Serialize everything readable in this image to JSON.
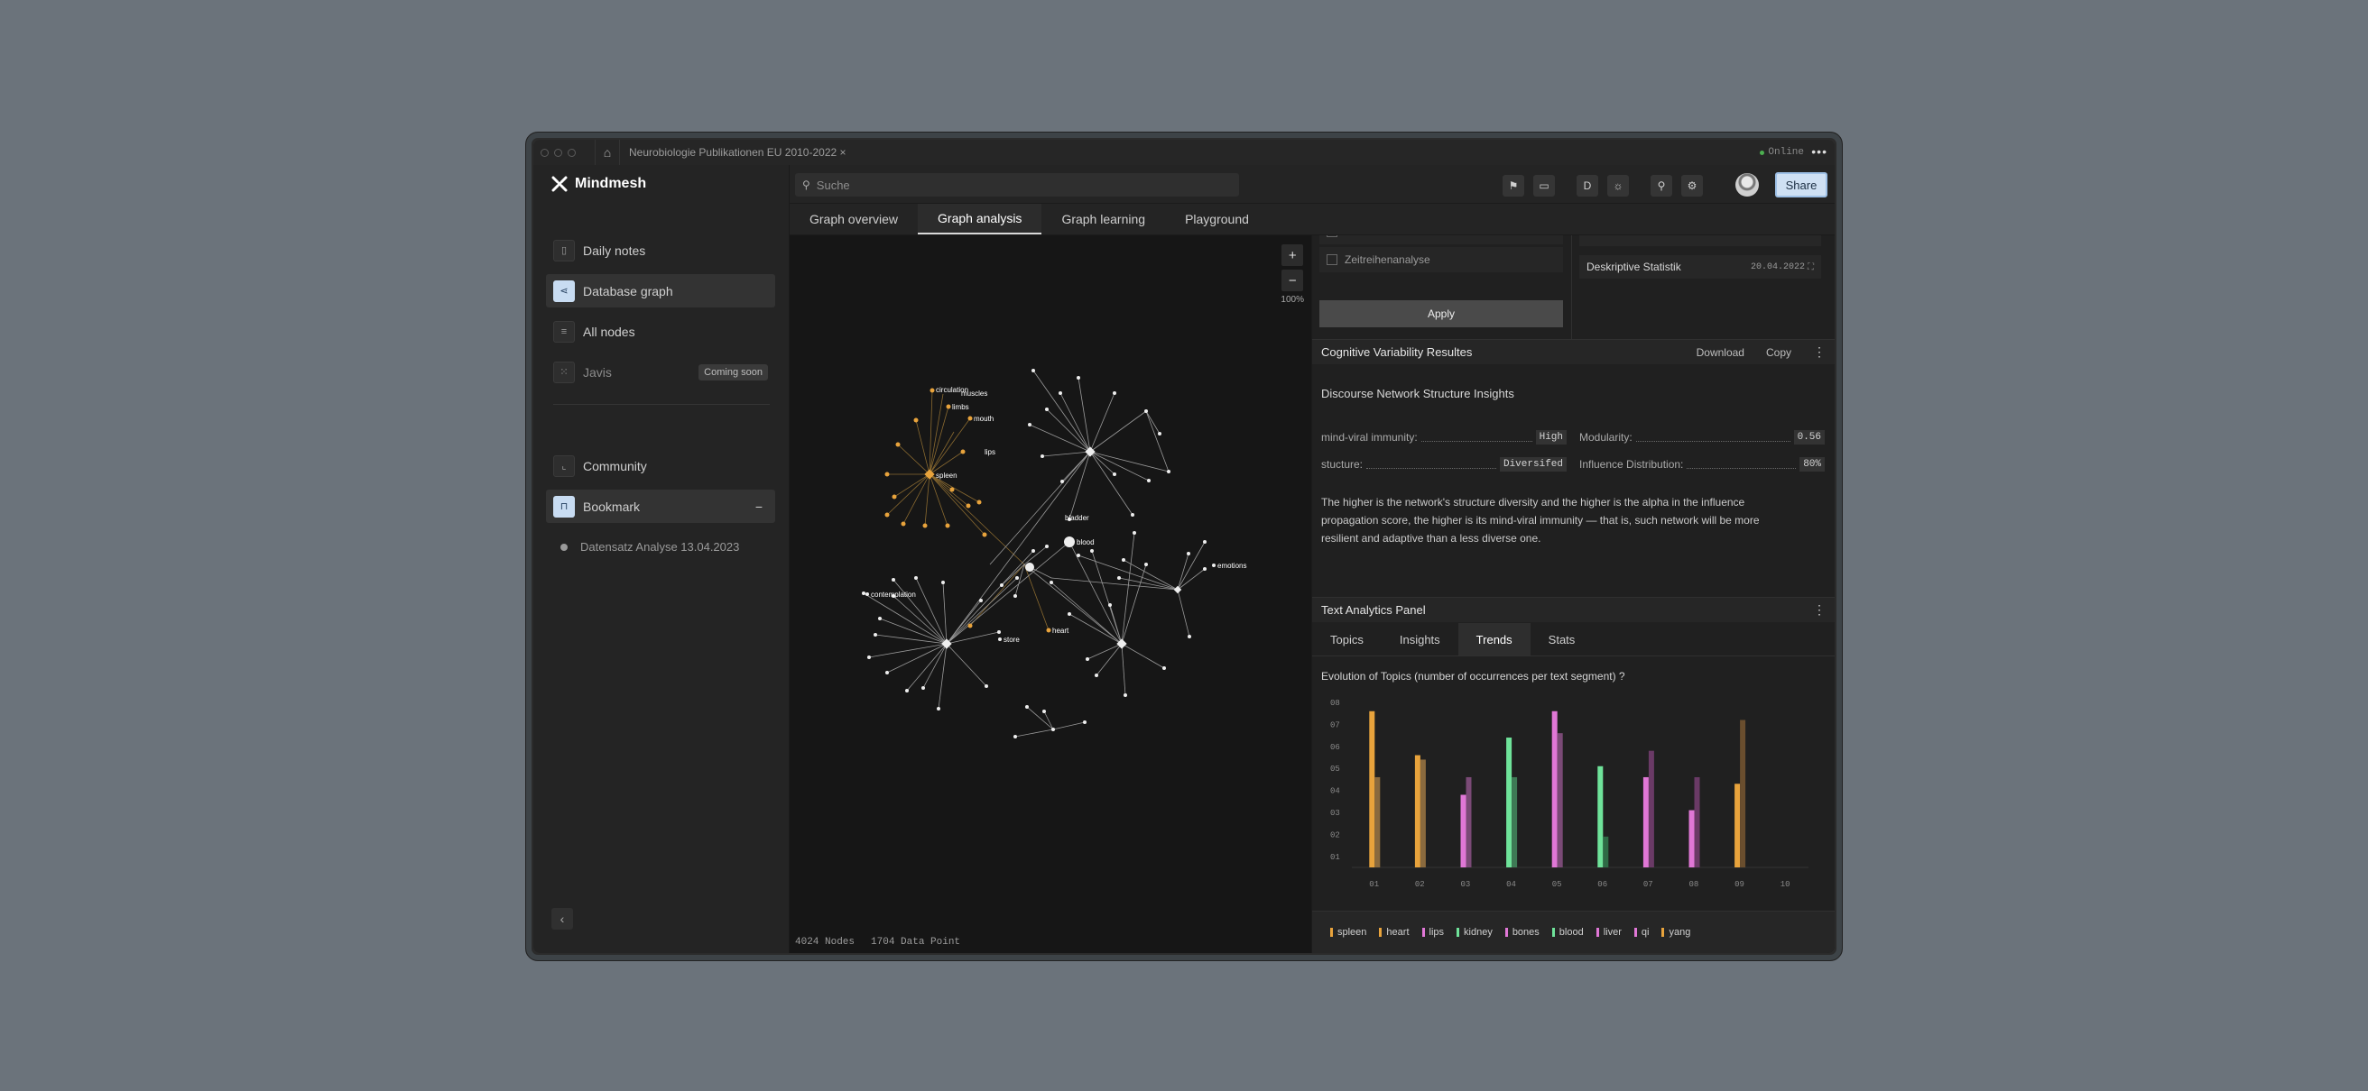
{
  "window": {
    "tab_title": "Neurobiologie Publikationen EU 2010-2022 ×",
    "status": "Online"
  },
  "brand": {
    "name": "Mindmesh"
  },
  "sidebar": {
    "items": [
      {
        "label": "Daily notes",
        "icon": "note-icon"
      },
      {
        "label": "Database graph",
        "icon": "graph-icon",
        "active": true
      },
      {
        "label": "All nodes",
        "icon": "list-icon"
      },
      {
        "label": "Javis",
        "icon": "grid-icon",
        "badge": "Coming soon"
      }
    ],
    "items2": [
      {
        "label": "Community",
        "icon": "community-icon"
      },
      {
        "label": "Bookmark",
        "icon": "bookmark-icon",
        "active": true,
        "action": "−"
      },
      {
        "label": "Datensatz Analyse 13.04.2023"
      }
    ]
  },
  "header": {
    "search_placeholder": "Suche",
    "btn_d": "D",
    "share_label": "Share"
  },
  "view_tabs": [
    "Graph overview",
    "Graph analysis",
    "Graph learning",
    "Playground"
  ],
  "graph": {
    "zoom_in": "+",
    "zoom_out": "−",
    "zoom_level": "100%",
    "nodes_count": "4024 Nodes",
    "data_points": "1704 Data Point",
    "labels": {
      "spleen": "spleen",
      "circulation": "circulation",
      "muscles": "muscles",
      "limbs": "limbs",
      "mouth": "mouth",
      "lips": "lips",
      "bladder": "bladder",
      "blood": "blood",
      "emotions": "emotions",
      "contemplation": "contemplation",
      "heart": "heart",
      "store": "store"
    }
  },
  "filters": {
    "row2": "Zeitreihenanalyse",
    "apply": "Apply"
  },
  "saved": {
    "name": "Deskriptive Statistik",
    "date": "20.04.2022"
  },
  "cognitive": {
    "title": "Cognitive Variability Resultes",
    "download": "Download",
    "copy": "Copy",
    "insight_title": "Discourse Network Structure Insights",
    "m1_label": "mind-viral immunity:",
    "m1_value": "High",
    "m2_label": "Modularity:",
    "m2_value": "0.56",
    "m3_label": "stucture:",
    "m3_value": "Diversifed",
    "m4_label": "Influence Distribution:",
    "m4_value": "80%",
    "paragraph": "The higher is the network's structure diversity and the higher is the alpha in the influence propagation score, the higher is its mind-viral immunity — that is, such network will be more resilient and adaptive than a less diverse one."
  },
  "text_panel": {
    "title": "Text Analytics Panel",
    "tabs": [
      "Topics",
      "Insights",
      "Trends",
      "Stats"
    ],
    "active_tab": "Trends"
  },
  "chart_data": {
    "type": "bar",
    "title": "Evolution of Topics (number of occurrences per text segment) ?",
    "categories": [
      "01",
      "02",
      "03",
      "04",
      "05",
      "06",
      "07",
      "08",
      "09",
      "10"
    ],
    "y_ticks": [
      "08",
      "07",
      "06",
      "05",
      "04",
      "03",
      "02",
      "01"
    ],
    "ylim": [
      0.5,
      8
    ],
    "bars": [
      {
        "cat": 0,
        "values": [
          7.6,
          4.6
        ],
        "colors": [
          "#e8a33c",
          "#8a6a3e"
        ]
      },
      {
        "cat": 1,
        "values": [
          5.6,
          5.4
        ],
        "colors": [
          "#e8a33c",
          "#8a6a3e"
        ]
      },
      {
        "cat": 2,
        "values": [
          3.8,
          4.6
        ],
        "colors": [
          "#e077d6",
          "#7a4a76"
        ]
      },
      {
        "cat": 3,
        "values": [
          6.4,
          4.6
        ],
        "colors": [
          "#6fe39a",
          "#3e7a55"
        ]
      },
      {
        "cat": 4,
        "values": [
          7.6,
          6.6
        ],
        "colors": [
          "#e077d6",
          "#7a4a76"
        ]
      },
      {
        "cat": 5,
        "values": [
          5.1,
          1.9
        ],
        "colors": [
          "#6fe39a",
          "#2e6a45"
        ]
      },
      {
        "cat": 6,
        "values": [
          4.6,
          5.8
        ],
        "colors": [
          "#e077d6",
          "#6a3a66"
        ]
      },
      {
        "cat": 7,
        "values": [
          3.1,
          4.6
        ],
        "colors": [
          "#e077d6",
          "#6a3a66"
        ]
      },
      {
        "cat": 8,
        "values": [
          4.3,
          7.2
        ],
        "colors": [
          "#e8a33c",
          "#6a4e2e"
        ]
      }
    ],
    "legend": [
      {
        "name": "spleen",
        "color": "#e8a33c"
      },
      {
        "name": "heart",
        "color": "#e8a33c"
      },
      {
        "name": "lips",
        "color": "#e077d6"
      },
      {
        "name": "kidney",
        "color": "#6fe39a"
      },
      {
        "name": "bones",
        "color": "#e077d6"
      },
      {
        "name": "blood",
        "color": "#6fe39a"
      },
      {
        "name": "liver",
        "color": "#e077d6"
      },
      {
        "name": "qi",
        "color": "#e077d6"
      },
      {
        "name": "yang",
        "color": "#e8a33c"
      }
    ]
  }
}
